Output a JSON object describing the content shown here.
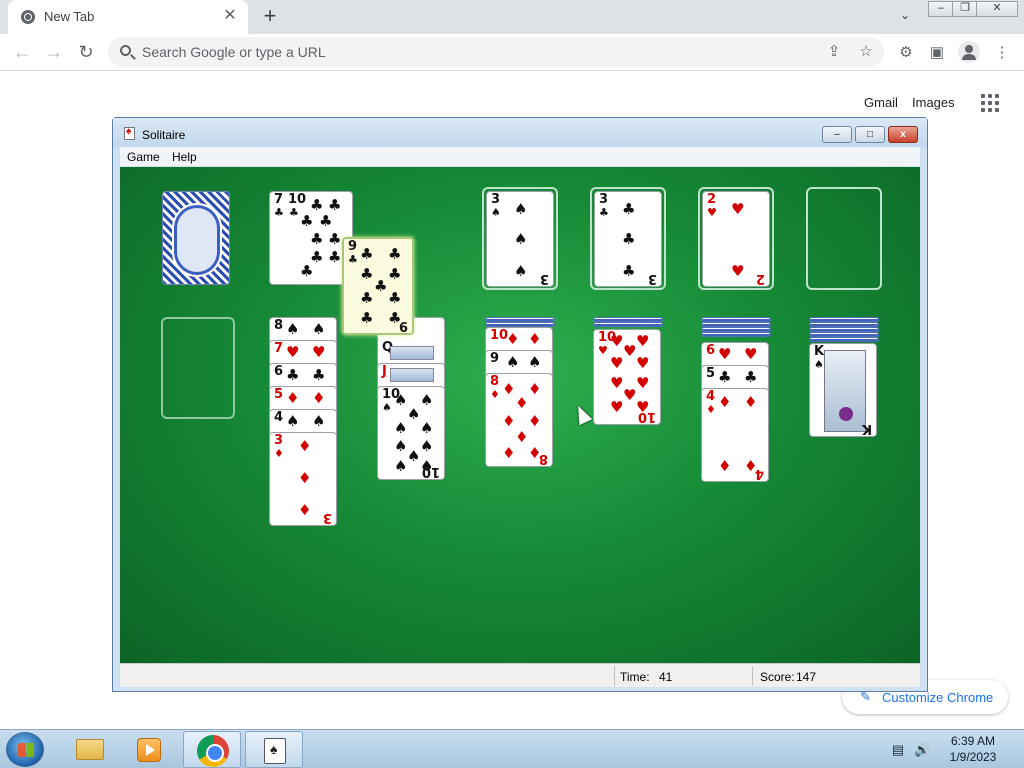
{
  "browser": {
    "tab_title": "New Tab",
    "tab_close": "✕",
    "new_tab": "+",
    "tab_search": "⌄",
    "window_minimize": "–",
    "window_restore": "❐",
    "window_close": "✕",
    "back": "←",
    "forward": "→",
    "reload": "↻",
    "omnibox_placeholder": "Search Google or type a URL",
    "share_icon": "⇪",
    "bookmark_icon": "☆",
    "extensions_icon": "⚙",
    "sidepanel_icon": "▣",
    "menu_icon": "⋮"
  },
  "ntp": {
    "gmail": "Gmail",
    "images": "Images",
    "customize": "Customize Chrome",
    "pencil": "✎"
  },
  "solitaire": {
    "title": "Solitaire",
    "menu": {
      "game": "Game",
      "help": "Help"
    },
    "min": "–",
    "max": "□",
    "close": "x",
    "status": {
      "time_label": "Time:",
      "time_value": "41",
      "score_label": "Score:",
      "score_value": "147"
    },
    "cards": {
      "waste": [
        {
          "rank": "7",
          "suit": "♣"
        },
        {
          "rank": "10",
          "suit": "♣"
        }
      ],
      "dragging": {
        "rank": "9",
        "suit": "♣"
      },
      "foundations": [
        {
          "rank": "3",
          "suit": "♠"
        },
        {
          "rank": "3",
          "suit": "♣"
        },
        {
          "rank": "2",
          "suit": "♥"
        }
      ],
      "col2": [
        {
          "rank": "8",
          "suit": "♠"
        },
        {
          "rank": "7",
          "suit": "♥"
        },
        {
          "rank": "6",
          "suit": "♣"
        },
        {
          "rank": "5",
          "suit": "♦"
        },
        {
          "rank": "4",
          "suit": "♠"
        },
        {
          "rank": "3",
          "suit": "♦"
        }
      ],
      "col3": [
        {
          "rank": "Q",
          "suit": "♠"
        },
        {
          "rank": "J",
          "suit": "♦"
        },
        {
          "rank": "10",
          "suit": "♠"
        }
      ],
      "col4": [
        {
          "rank": "10",
          "suit": "♦"
        },
        {
          "rank": "9",
          "suit": "♠"
        },
        {
          "rank": "8",
          "suit": "♦"
        }
      ],
      "col5": [
        {
          "rank": "10",
          "suit": "♥"
        }
      ],
      "col6": [
        {
          "rank": "6",
          "suit": "♥"
        },
        {
          "rank": "5",
          "suit": "♣"
        },
        {
          "rank": "4",
          "suit": "♦"
        }
      ],
      "col7": [
        {
          "rank": "K",
          "suit": "♠"
        }
      ]
    }
  },
  "taskbar": {
    "time": "6:39 AM",
    "date": "1/9/2023",
    "network_icon": "▤",
    "volume_icon": "🔊"
  },
  "colors": {
    "felt": "#168a36",
    "red_suit": "#d40000",
    "black_suit": "#111111",
    "chrome_accent": "#1a73e8"
  }
}
